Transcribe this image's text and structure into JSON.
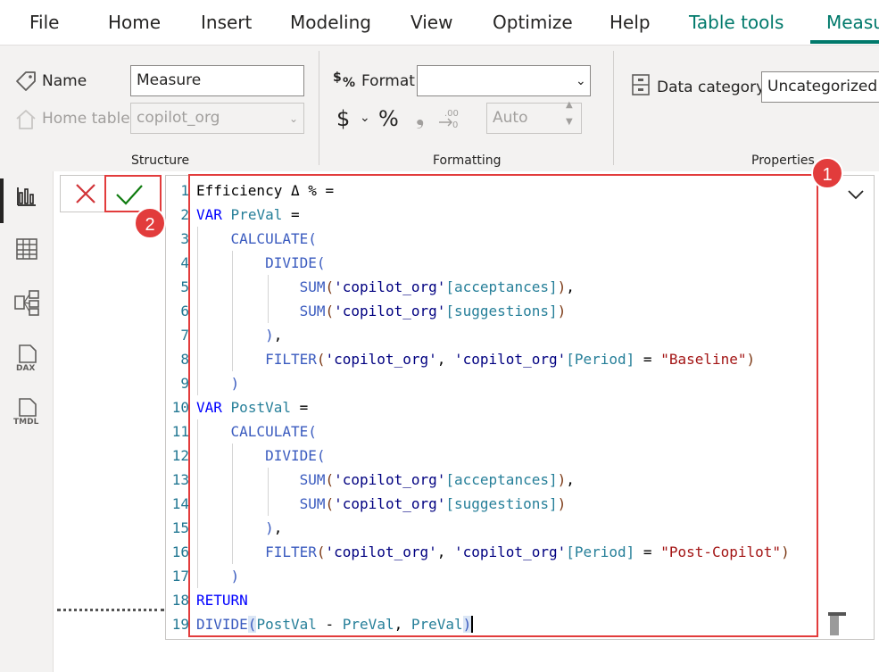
{
  "menu": {
    "items": [
      "File",
      "Home",
      "Insert",
      "Modeling",
      "View",
      "Optimize",
      "Help"
    ],
    "context_tab": "Table tools",
    "active_tab": "Measu"
  },
  "ribbon": {
    "structure": {
      "label": "Structure",
      "name_label": "Name",
      "name_value": "Measure",
      "home_table_label": "Home table",
      "home_table_value": "copilot_org"
    },
    "formatting": {
      "label": "Formatting",
      "format_label": "Format",
      "format_value": "",
      "currency_symbol": "$",
      "percent_symbol": "%",
      "comma_symbol": "❟",
      "decimals_value": "Auto"
    },
    "properties": {
      "label": "Properties",
      "data_category_label": "Data category",
      "data_category_value": "Uncategorized"
    }
  },
  "left_nav": {
    "items": [
      "report-view-icon",
      "table-view-icon",
      "model-view-icon",
      "dax-query-view-icon",
      "tmdl-view-icon"
    ],
    "dax_text": "DAX",
    "tmdl_text": "TMDL"
  },
  "formula_bar": {
    "line_numbers": [
      "1",
      "2",
      "3",
      "4",
      "5",
      "6",
      "7",
      "8",
      "9",
      "10",
      "11",
      "12",
      "13",
      "14",
      "15",
      "16",
      "17",
      "18",
      "19"
    ],
    "code": {
      "l1": "Efficiency Δ % =",
      "kw_var": "VAR",
      "preval": "PreVal",
      "postval": "PostVal",
      "eq": " =",
      "calculate": "CALCULATE",
      "divide": "DIVIDE",
      "sum": "SUM",
      "filter": "FILTER",
      "return_kw": "RETURN",
      "table_q": "'copilot_org'",
      "acceptances": "[acceptances]",
      "suggestions": "[suggestions]",
      "period": "[Period]",
      "baseline": "\"Baseline\"",
      "post_copilot": "\"Post-Copilot\""
    }
  },
  "callouts": [
    "1",
    "2"
  ],
  "colors": {
    "accent": "#00796b",
    "callout": "#e23c3c",
    "keyword": "#0000ff",
    "function": "#3a5bbf",
    "string": "#a31515"
  }
}
